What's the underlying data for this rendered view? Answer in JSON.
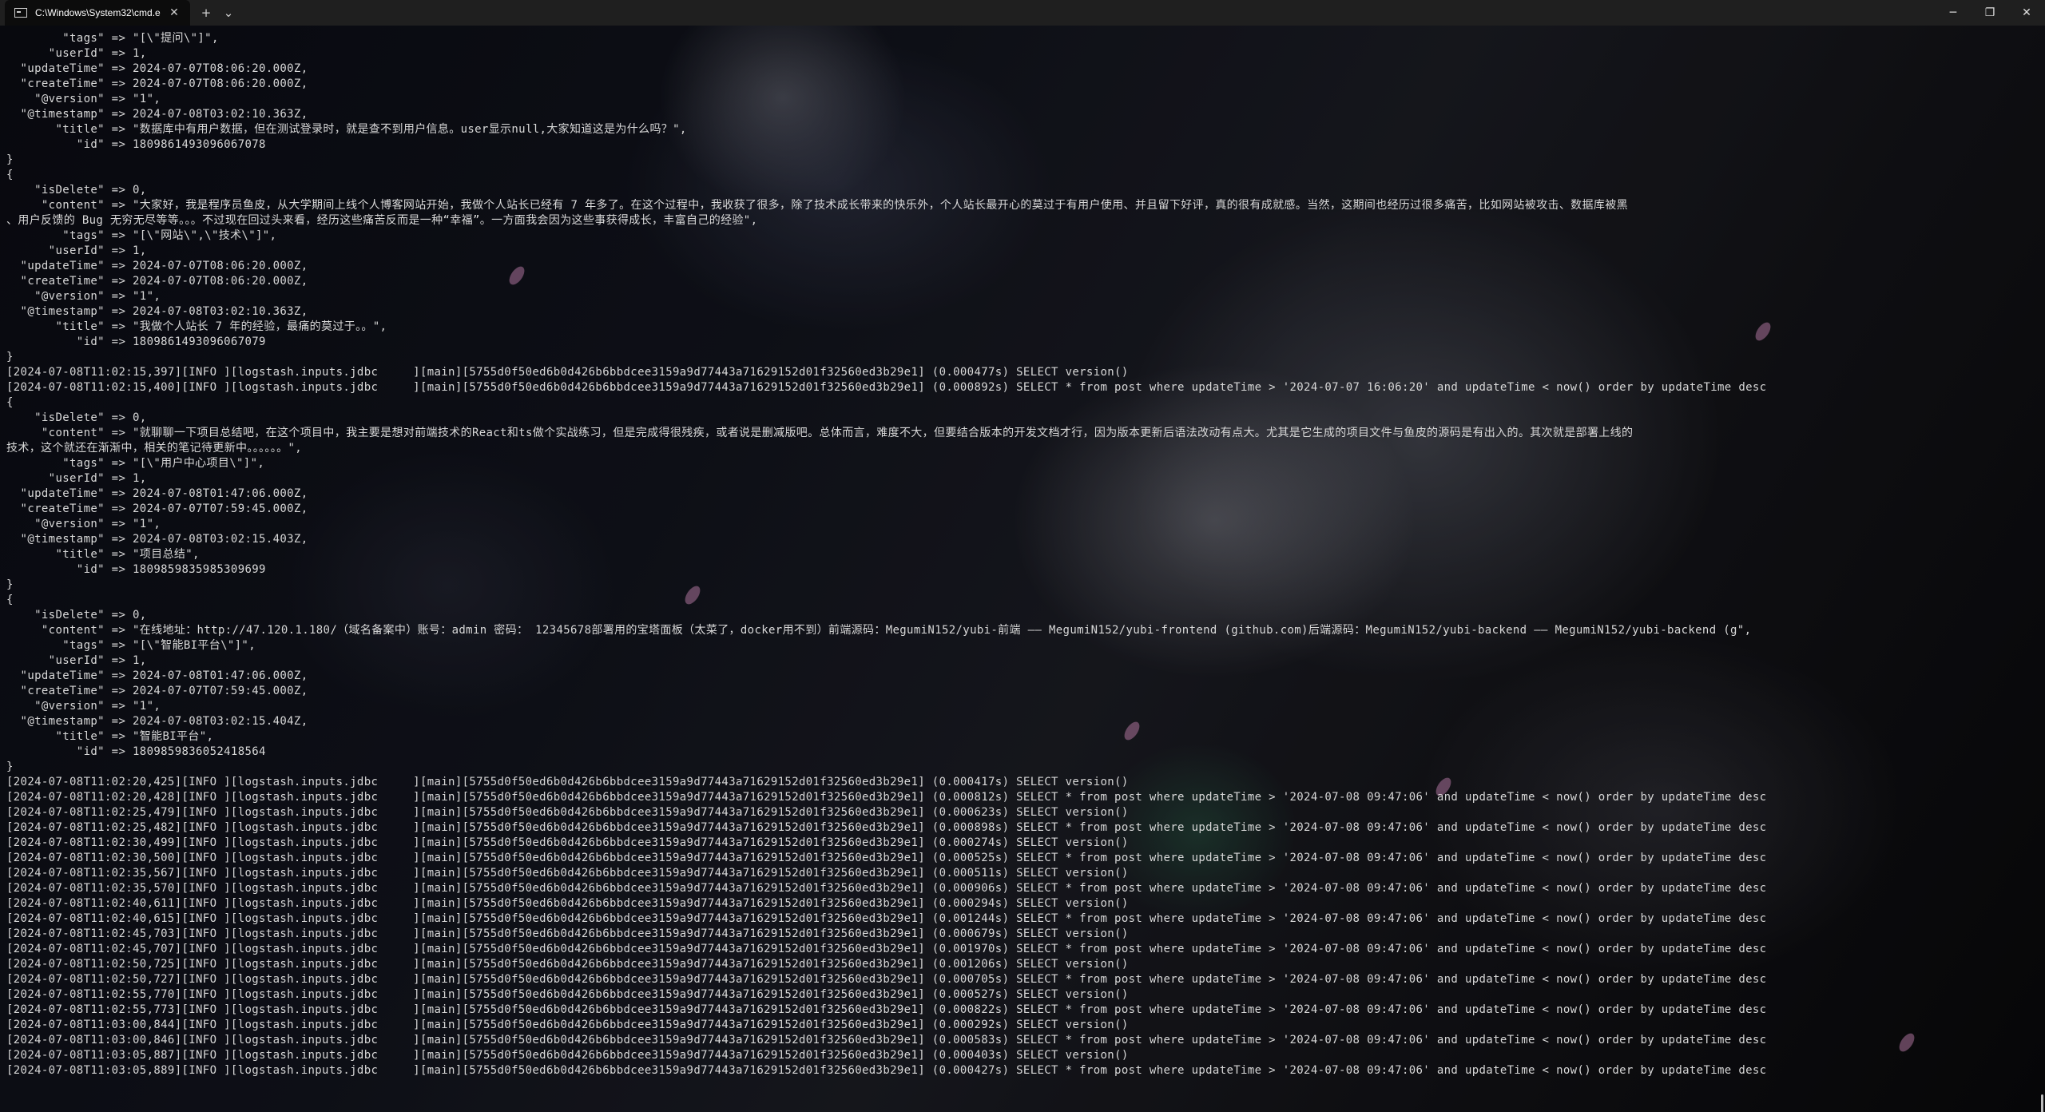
{
  "window": {
    "tab_title": "C:\\Windows\\System32\\cmd.e",
    "tab_icon": "terminal-icon",
    "close_tab": "✕",
    "new_tab": "+",
    "dropdown": "⌄",
    "minimize": "─",
    "restore": "❐",
    "close": "✕"
  },
  "log_lines": [
    "        \"tags\" => \"[\\\"提问\\\"]\",",
    "      \"userId\" => 1,",
    "  \"updateTime\" => 2024-07-07T08:06:20.000Z,",
    "  \"createTime\" => 2024-07-07T08:06:20.000Z,",
    "    \"@version\" => \"1\",",
    "  \"@timestamp\" => 2024-07-08T03:02:10.363Z,",
    "       \"title\" => \"数据库中有用户数据，但在测试登录时，就是查不到用户信息。user显示null,大家知道这是为什么吗？\",",
    "          \"id\" => 1809861493096067078",
    "}",
    "{",
    "    \"isDelete\" => 0,",
    "     \"content\" => \"大家好，我是程序员鱼皮，从大学期间上线个人博客网站开始，我做个人站长已经有 7 年多了。在这个过程中，我收获了很多，除了技术成长带来的快乐外，个人站长最开心的莫过于有用户使用、并且留下好评，真的很有成就感。当然，这期间也经历过很多痛苦，比如网站被攻击、数据库被黑",
    "、用户反馈的 Bug 无穷无尽等等。。。不过现在回过头来看，经历这些痛苦反而是一种“幸福”。一方面我会因为这些事获得成长，丰富自己的经验\",",
    "        \"tags\" => \"[\\\"网站\\\",\\\"技术\\\"]\",",
    "      \"userId\" => 1,",
    "  \"updateTime\" => 2024-07-07T08:06:20.000Z,",
    "  \"createTime\" => 2024-07-07T08:06:20.000Z,",
    "    \"@version\" => \"1\",",
    "  \"@timestamp\" => 2024-07-08T03:02:10.363Z,",
    "       \"title\" => \"我做个人站长 7 年的经验，最痛的莫过于。。\",",
    "          \"id\" => 1809861493096067079",
    "}",
    "[2024-07-08T11:02:15,397][INFO ][logstash.inputs.jdbc     ][main][5755d0f50ed6b0d426b6bbdcee3159a9d77443a71629152d01f32560ed3b29e1] (0.000477s) SELECT version()",
    "[2024-07-08T11:02:15,400][INFO ][logstash.inputs.jdbc     ][main][5755d0f50ed6b0d426b6bbdcee3159a9d77443a71629152d01f32560ed3b29e1] (0.000892s) SELECT * from post where updateTime > '2024-07-07 16:06:20' and updateTime < now() order by updateTime desc",
    "{",
    "    \"isDelete\" => 0,",
    "     \"content\" => \"就聊聊一下项目总结吧，在这个项目中，我主要是想对前端技术的React和ts做个实战练习，但是完成得很残疾，或者说是删减版吧。总体而言，难度不大，但要结合版本的开发文档才行，因为版本更新后语法改动有点大。尤其是它生成的项目文件与鱼皮的源码是有出入的。其次就是部署上线的",
    "技术，这个就还在渐渐中，相关的笔记待更新中。。。。。。\",",
    "        \"tags\" => \"[\\\"用户中心项目\\\"]\",",
    "      \"userId\" => 1,",
    "  \"updateTime\" => 2024-07-08T01:47:06.000Z,",
    "  \"createTime\" => 2024-07-07T07:59:45.000Z,",
    "    \"@version\" => \"1\",",
    "  \"@timestamp\" => 2024-07-08T03:02:15.403Z,",
    "       \"title\" => \"项目总结\",",
    "          \"id\" => 1809859835985309699",
    "}",
    "{",
    "    \"isDelete\" => 0,",
    "     \"content\" => \"在线地址：http://47.120.1.180/（域名备案中）账号：admin 密码： 12345678部署用的宝塔面板（太菜了，docker用不到）前端源码：MegumiN152/yubi-前端 —— MegumiN152/yubi-frontend (github.com)后端源码：MegumiN152/yubi-backend —— MegumiN152/yubi-backend (g\",",
    "        \"tags\" => \"[\\\"智能BI平台\\\"]\",",
    "      \"userId\" => 1,",
    "  \"updateTime\" => 2024-07-08T01:47:06.000Z,",
    "  \"createTime\" => 2024-07-07T07:59:45.000Z,",
    "    \"@version\" => \"1\",",
    "  \"@timestamp\" => 2024-07-08T03:02:15.404Z,",
    "       \"title\" => \"智能BI平台\",",
    "          \"id\" => 1809859836052418564",
    "}",
    "[2024-07-08T11:02:20,425][INFO ][logstash.inputs.jdbc     ][main][5755d0f50ed6b0d426b6bbdcee3159a9d77443a71629152d01f32560ed3b29e1] (0.000417s) SELECT version()",
    "[2024-07-08T11:02:20,428][INFO ][logstash.inputs.jdbc     ][main][5755d0f50ed6b0d426b6bbdcee3159a9d77443a71629152d01f32560ed3b29e1] (0.000812s) SELECT * from post where updateTime > '2024-07-08 09:47:06' and updateTime < now() order by updateTime desc",
    "[2024-07-08T11:02:25,479][INFO ][logstash.inputs.jdbc     ][main][5755d0f50ed6b0d426b6bbdcee3159a9d77443a71629152d01f32560ed3b29e1] (0.000623s) SELECT version()",
    "[2024-07-08T11:02:25,482][INFO ][logstash.inputs.jdbc     ][main][5755d0f50ed6b0d426b6bbdcee3159a9d77443a71629152d01f32560ed3b29e1] (0.000898s) SELECT * from post where updateTime > '2024-07-08 09:47:06' and updateTime < now() order by updateTime desc",
    "[2024-07-08T11:02:30,499][INFO ][logstash.inputs.jdbc     ][main][5755d0f50ed6b0d426b6bbdcee3159a9d77443a71629152d01f32560ed3b29e1] (0.000274s) SELECT version()",
    "[2024-07-08T11:02:30,500][INFO ][logstash.inputs.jdbc     ][main][5755d0f50ed6b0d426b6bbdcee3159a9d77443a71629152d01f32560ed3b29e1] (0.000525s) SELECT * from post where updateTime > '2024-07-08 09:47:06' and updateTime < now() order by updateTime desc",
    "[2024-07-08T11:02:35,567][INFO ][logstash.inputs.jdbc     ][main][5755d0f50ed6b0d426b6bbdcee3159a9d77443a71629152d01f32560ed3b29e1] (0.000511s) SELECT version()",
    "[2024-07-08T11:02:35,570][INFO ][logstash.inputs.jdbc     ][main][5755d0f50ed6b0d426b6bbdcee3159a9d77443a71629152d01f32560ed3b29e1] (0.000906s) SELECT * from post where updateTime > '2024-07-08 09:47:06' and updateTime < now() order by updateTime desc",
    "[2024-07-08T11:02:40,611][INFO ][logstash.inputs.jdbc     ][main][5755d0f50ed6b0d426b6bbdcee3159a9d77443a71629152d01f32560ed3b29e1] (0.000294s) SELECT version()",
    "[2024-07-08T11:02:40,615][INFO ][logstash.inputs.jdbc     ][main][5755d0f50ed6b0d426b6bbdcee3159a9d77443a71629152d01f32560ed3b29e1] (0.001244s) SELECT * from post where updateTime > '2024-07-08 09:47:06' and updateTime < now() order by updateTime desc",
    "[2024-07-08T11:02:45,703][INFO ][logstash.inputs.jdbc     ][main][5755d0f50ed6b0d426b6bbdcee3159a9d77443a71629152d01f32560ed3b29e1] (0.000679s) SELECT version()",
    "[2024-07-08T11:02:45,707][INFO ][logstash.inputs.jdbc     ][main][5755d0f50ed6b0d426b6bbdcee3159a9d77443a71629152d01f32560ed3b29e1] (0.001970s) SELECT * from post where updateTime > '2024-07-08 09:47:06' and updateTime < now() order by updateTime desc",
    "[2024-07-08T11:02:50,725][INFO ][logstash.inputs.jdbc     ][main][5755d0f50ed6b0d426b6bbdcee3159a9d77443a71629152d01f32560ed3b29e1] (0.001206s) SELECT version()",
    "[2024-07-08T11:02:50,727][INFO ][logstash.inputs.jdbc     ][main][5755d0f50ed6b0d426b6bbdcee3159a9d77443a71629152d01f32560ed3b29e1] (0.000705s) SELECT * from post where updateTime > '2024-07-08 09:47:06' and updateTime < now() order by updateTime desc",
    "[2024-07-08T11:02:55,770][INFO ][logstash.inputs.jdbc     ][main][5755d0f50ed6b0d426b6bbdcee3159a9d77443a71629152d01f32560ed3b29e1] (0.000527s) SELECT version()",
    "[2024-07-08T11:02:55,773][INFO ][logstash.inputs.jdbc     ][main][5755d0f50ed6b0d426b6bbdcee3159a9d77443a71629152d01f32560ed3b29e1] (0.000822s) SELECT * from post where updateTime > '2024-07-08 09:47:06' and updateTime < now() order by updateTime desc",
    "[2024-07-08T11:03:00,844][INFO ][logstash.inputs.jdbc     ][main][5755d0f50ed6b0d426b6bbdcee3159a9d77443a71629152d01f32560ed3b29e1] (0.000292s) SELECT version()",
    "[2024-07-08T11:03:00,846][INFO ][logstash.inputs.jdbc     ][main][5755d0f50ed6b0d426b6bbdcee3159a9d77443a71629152d01f32560ed3b29e1] (0.000583s) SELECT * from post where updateTime > '2024-07-08 09:47:06' and updateTime < now() order by updateTime desc",
    "[2024-07-08T11:03:05,887][INFO ][logstash.inputs.jdbc     ][main][5755d0f50ed6b0d426b6bbdcee3159a9d77443a71629152d01f32560ed3b29e1] (0.000403s) SELECT version()",
    "[2024-07-08T11:03:05,889][INFO ][logstash.inputs.jdbc     ][main][5755d0f50ed6b0d426b6bbdcee3159a9d77443a71629152d01f32560ed3b29e1] (0.000427s) SELECT * from post where updateTime > '2024-07-08 09:47:06' and updateTime < now() order by updateTime desc"
  ]
}
